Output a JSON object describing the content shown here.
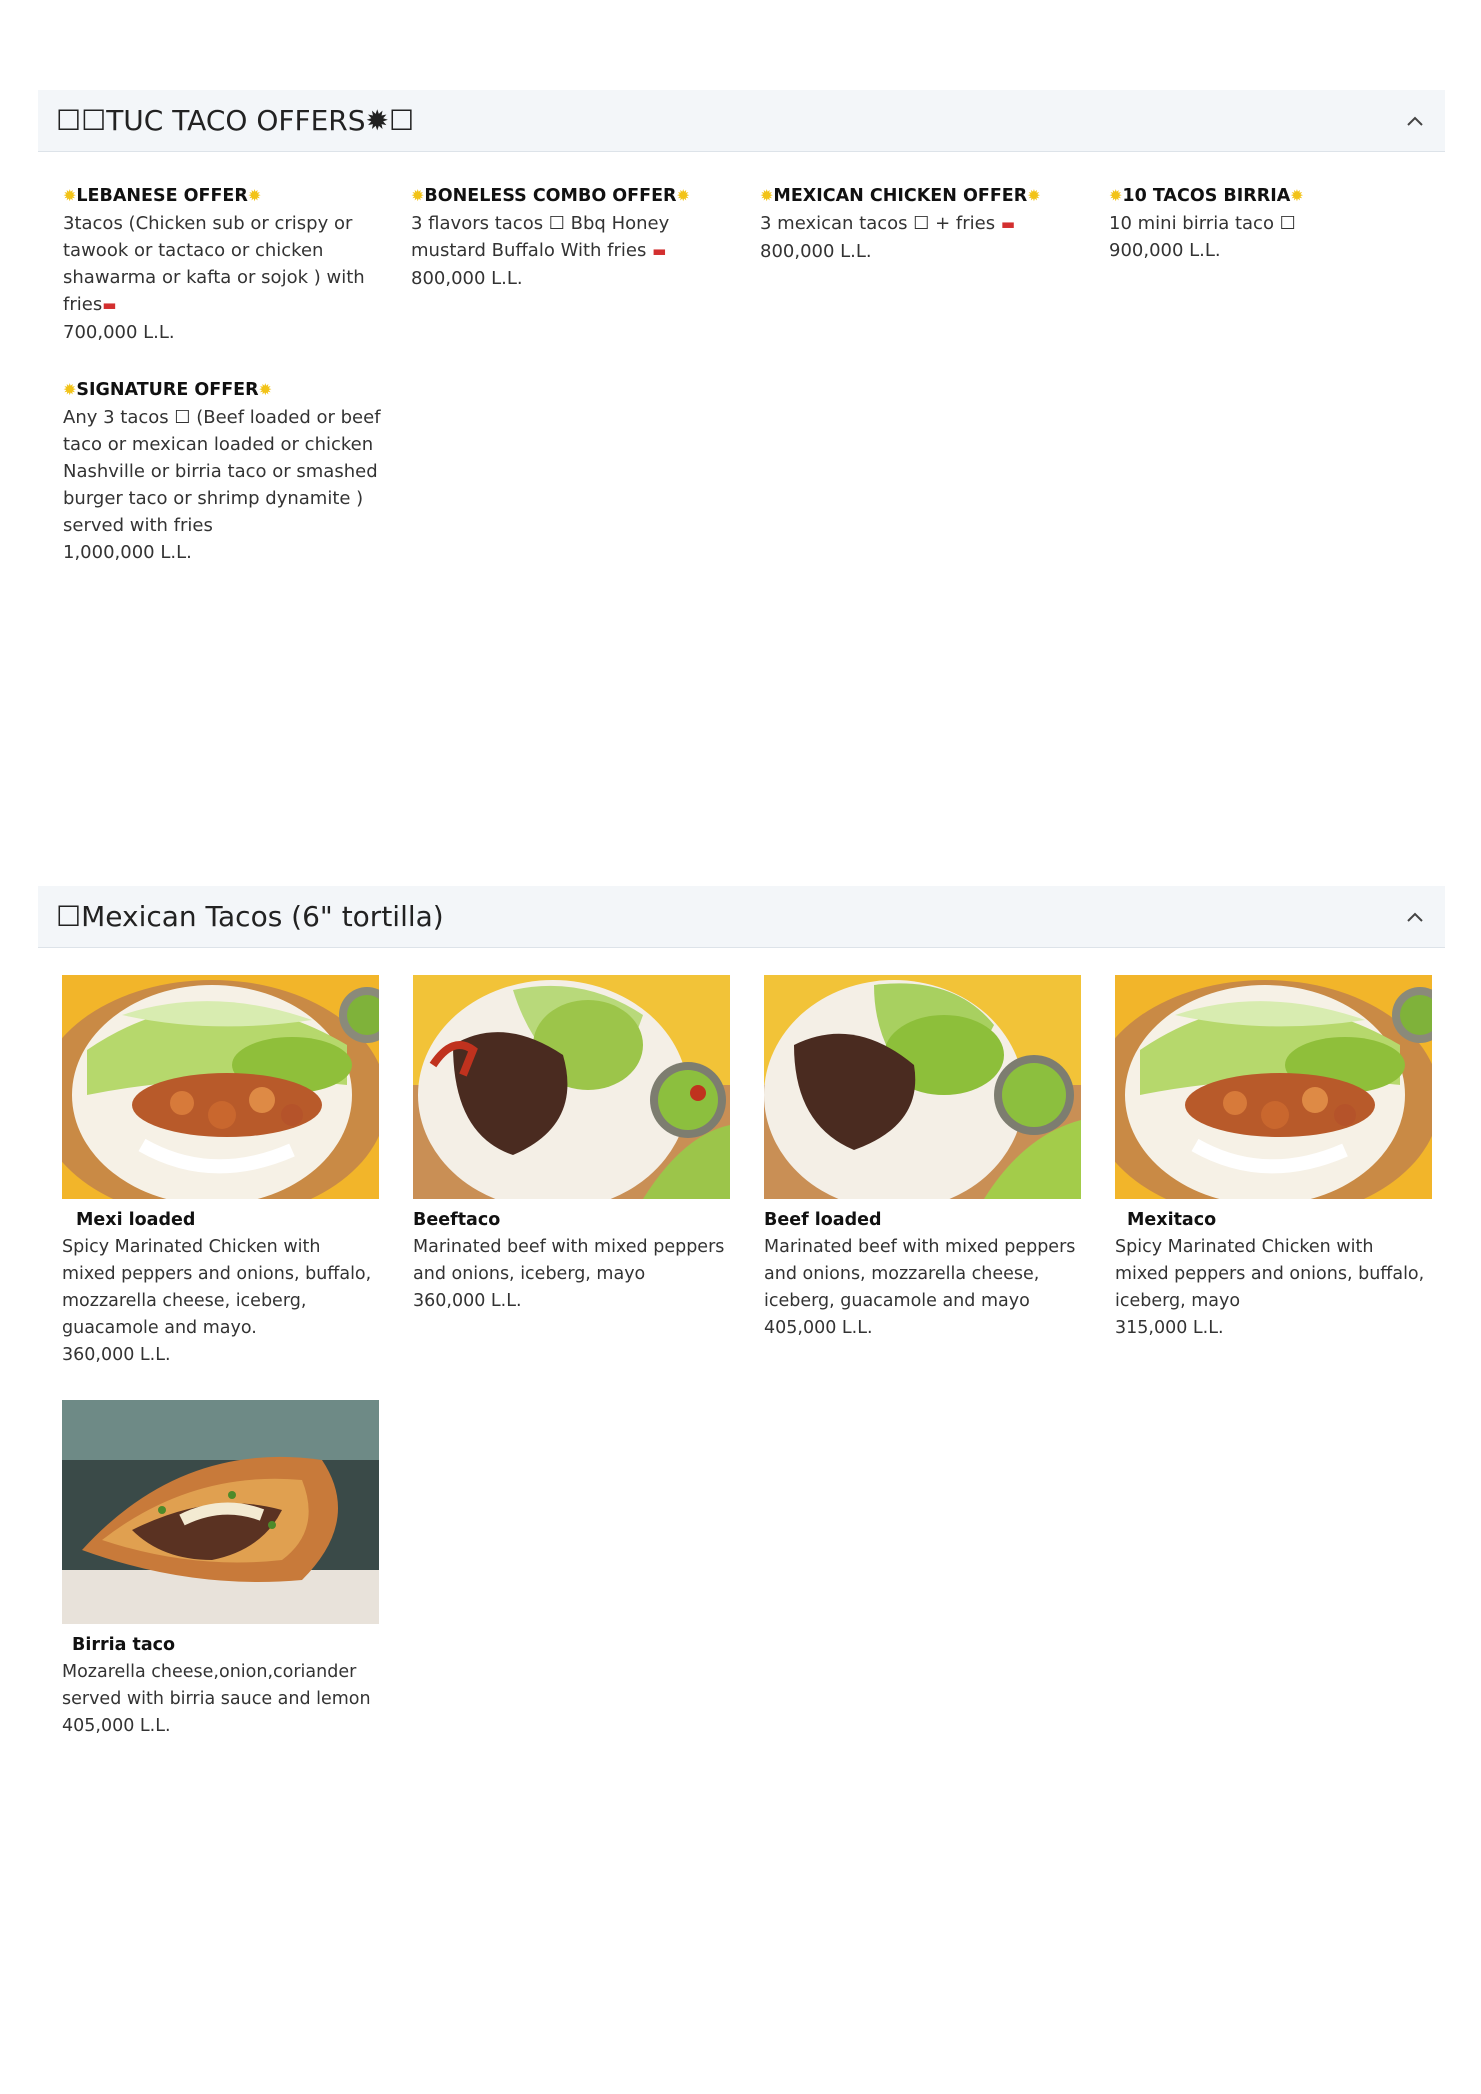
{
  "offers_section": {
    "title": "☐☐TUC TACO OFFERS✹☐",
    "offers": [
      {
        "title": "LEBANESE OFFER",
        "desc": "3tacos (Chicken sub or crispy or tawook or tactaco or chicken shawarma or kafta or sojok ) with fries",
        "price": "700,000 L.L."
      },
      {
        "title": "BONELESS COMBO OFFER",
        "desc": "3 flavors tacos ☐ Bbq Honey mustard Buffalo With fries",
        "price": "800,000 L.L."
      },
      {
        "title": "MEXICAN CHICKEN OFFER",
        "desc": "3 mexican tacos ☐ + fries",
        "price": "800,000 L.L."
      },
      {
        "title": "10 TACOS BIRRIA",
        "desc": "10 mini birria taco ☐",
        "price": "900,000 L.L."
      },
      {
        "title": "SIGNATURE OFFER",
        "desc": "Any 3 tacos ☐ (Beef loaded or beef taco or mexican loaded or chicken Nashville or birria taco or smashed burger taco or shrimp dynamite ) served with fries",
        "price": "1,000,000 L.L."
      }
    ]
  },
  "tacos_section": {
    "title": "☐Mexican Tacos (6\" tortilla)",
    "items": [
      {
        "name": "Mexi loaded",
        "desc": "Spicy Marinated Chicken with mixed peppers and onions, buffalo, mozzarella cheese, iceberg, guacamole and mayo.",
        "price": "360,000 L.L."
      },
      {
        "name": "Beeftaco",
        "desc": "Marinated beef with mixed peppers and onions, iceberg, mayo",
        "price": "360,000 L.L."
      },
      {
        "name": "Beef loaded",
        "desc": "Marinated beef with mixed peppers and onions, mozzarella cheese, iceberg, guacamole and mayo",
        "price": "405,000 L.L."
      },
      {
        "name": "Mexitaco",
        "desc": "Spicy Marinated Chicken with mixed peppers and onions, buffalo, iceberg, mayo",
        "price": "315,000 L.L."
      },
      {
        "name": "Birria taco",
        "desc": "Mozarella cheese,onion,coriander served with birria sauce and lemon",
        "price": "405,000 L.L."
      }
    ]
  },
  "icons": {
    "collapse": "chevron-up-icon",
    "offer_marker": "sun-icon",
    "fries": "fries-icon"
  },
  "colors": {
    "header_bg": "#f3f6f9",
    "sun": "#f2c318",
    "fries": "#d32f2f"
  }
}
